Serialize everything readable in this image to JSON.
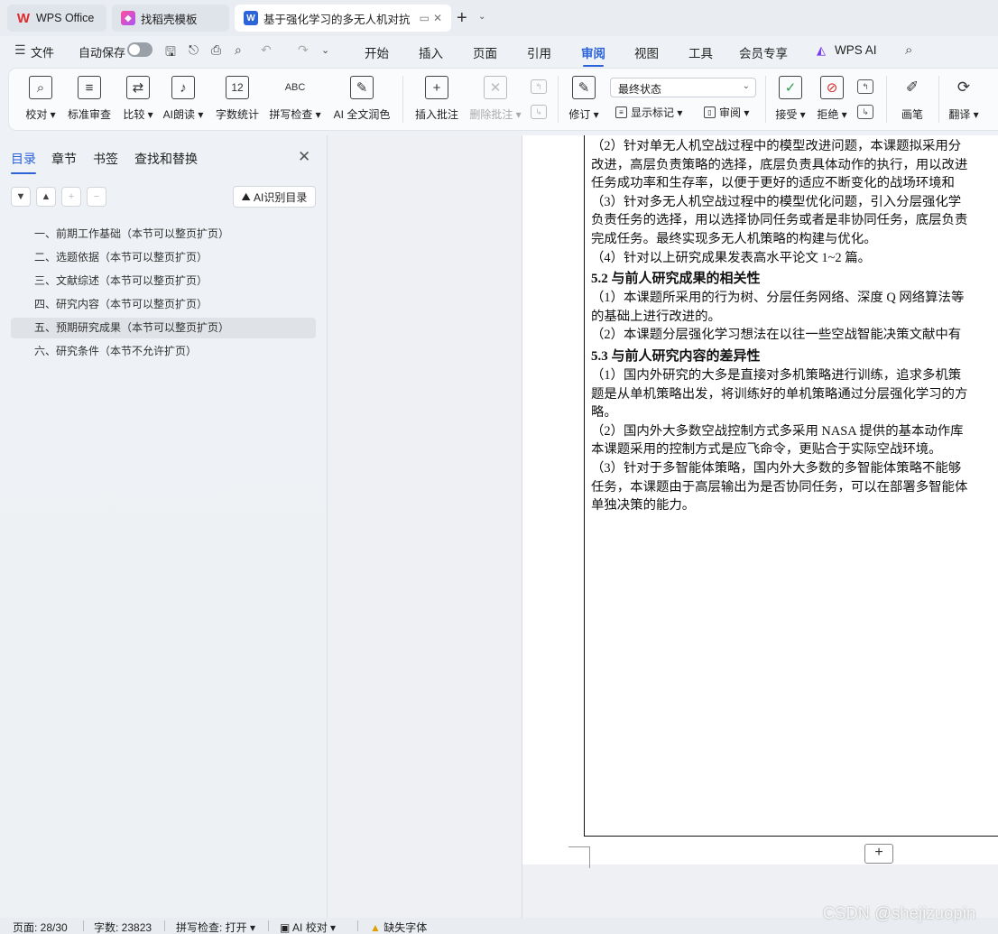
{
  "tabs": [
    {
      "title": "WPS Office"
    },
    {
      "title": "找稻壳模板"
    },
    {
      "title": "基于强化学习的多无人机对抗"
    }
  ],
  "menubar": {
    "file": "文件",
    "autosave": "自动保存",
    "tabs": [
      "开始",
      "插入",
      "页面",
      "引用",
      "审阅",
      "视图",
      "工具",
      "会员专享",
      "WPS AI"
    ]
  },
  "ribbon": {
    "proofread": "校对",
    "std_review": "标准审查",
    "compare": "比较",
    "ai_read": "AI朗读",
    "word_count": "字数统计",
    "spell_check": "拼写检查",
    "ai_polish": "AI 全文润色",
    "insert_comment": "插入批注",
    "delete_comment": "删除批注",
    "revise": "修订",
    "final_state": "最终状态",
    "show_marks": "显示标记",
    "review": "审阅",
    "accept": "接受",
    "reject": "拒绝",
    "pen": "画笔",
    "translate": "翻译",
    "spell_icon_text": "ABC",
    "count_icon_text": "12"
  },
  "nav": {
    "tabs": [
      "目录",
      "章节",
      "书签",
      "查找和替换"
    ],
    "ai_toc": "AI识别目录",
    "toc": [
      "一、前期工作基础（本节可以整页扩页）",
      "二、选题依据（本节可以整页扩页）",
      "三、文献综述（本节可以整页扩页）",
      "四、研究内容（本节可以整页扩页）",
      "五、预期研究成果（本节可以整页扩页）",
      "六、研究条件（本节不允许扩页）"
    ]
  },
  "doc": {
    "lines": [
      "（2）针对单无人机空战过程中的模型改进问题，本课题拟采用分",
      "改进，高层负责策略的选择，底层负责具体动作的执行，用以改进",
      "任务成功率和生存率，以便于更好的适应不断变化的战场环境和",
      "（3）针对多无人机空战过程中的模型优化问题，引入分层强化学",
      "负责任务的选择，用以选择协同任务或者是非协同任务，底层负责",
      "完成任务。最终实现多无人机策略的构建与优化。",
      "（4）针对以上研究成果发表高水平论文 1~2 篇。"
    ],
    "heading_52": "5.2 与前人研究成果的相关性",
    "lines_52": [
      "（1）本课题所采用的行为树、分层任务网络、深度 Q 网络算法等",
      "的基础上进行改进的。",
      "（2）本课题分层强化学习想法在以往一些空战智能决策文献中有"
    ],
    "heading_53": "5.3 与前人研究内容的差异性",
    "lines_53": [
      "（1）国内外研究的大多是直接对多机策略进行训练，追求多机策",
      "题是从单机策略出发，将训练好的单机策略通过分层强化学习的方",
      "略。",
      "（2）国内外大多数空战控制方式多采用 NASA 提供的基本动作库",
      "本课题采用的控制方式是应飞命令，更贴合于实际空战环境。",
      "（3）针对于多智能体策略，国内外大多数的多智能体策略不能够",
      "任务，本课题由于高层输出为是否协同任务，可以在部署多智能体",
      "单独决策的能力。"
    ]
  },
  "status": {
    "page": "页面: 28/30",
    "words": "字数: 23823",
    "spell": "拼写检查: 打开",
    "ai_proof": "AI 校对",
    "missing_font": "缺失字体"
  },
  "watermark": "CSDN @shejizuopin"
}
